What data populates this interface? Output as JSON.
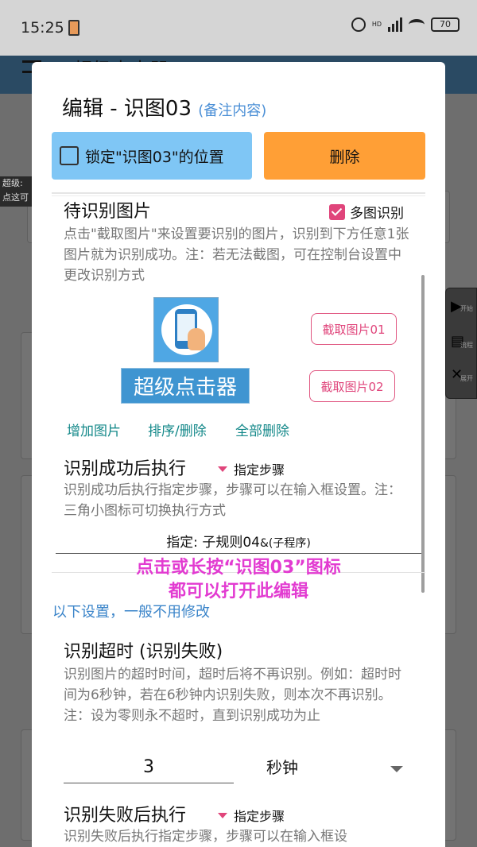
{
  "status_bar": {
    "time": "15:25",
    "network": "HD",
    "battery": "70"
  },
  "app_bar": {
    "title": "超级点击器"
  },
  "background": {
    "tooltip": "超级:\n点这可"
  },
  "side_panel": {
    "labels": [
      "开始",
      "流程",
      "展开"
    ]
  },
  "dialog": {
    "title": "编辑 - 识图03",
    "title_note": "(备注内容)",
    "lock_label": "锁定\"识图03\"的位置",
    "delete_label": "删除",
    "image_section": {
      "heading": "待识别图片",
      "multi_label": "多图识别",
      "multi_checked": true,
      "desc": "点击\"截取图片\"来设置要识别的图片，识别到下方任意1张图片就为识别成功。注：若无法截图，可在控制台设置中更改识别方式",
      "image2_text": "超级点击器",
      "capture1": "截取图片01",
      "capture2": "截取图片02",
      "links": [
        "增加图片",
        "排序/删除",
        "全部删除"
      ]
    },
    "success_section": {
      "heading": "识别成功后执行",
      "select": "指定步骤",
      "desc": "识别成功后执行指定步骤，步骤可以在输入框设置。注：三角小图标可切换执行方式",
      "assigned_prefix": "指定: 子规则04",
      "assigned_suffix": "&(子程序)"
    },
    "overlay": {
      "line1": "点击或长按“识图03”图标",
      "line2": "都可以打开此编辑"
    },
    "note": "以下设置，一般不用修改",
    "timeout_section": {
      "heading": "识别超时 (识别失败)",
      "desc": "识别图片的超时时间，超时后将不再识别。例如：超时时间为6秒钟，若在6秒钟内识别失败，则本次不再识别。注：设为零则永不超时，直到识别成功为止",
      "value": "3",
      "unit": "秒钟"
    },
    "fail_section": {
      "heading": "识别失败后执行",
      "select": "指定步骤",
      "desc": "识别失败后执行指定步骤，步骤可以在输入框设"
    }
  },
  "colors": {
    "primary_blue": "#7fc6f5",
    "delete_orange": "#ff9f36",
    "accent_pink": "#e0457b",
    "teal_link": "#15898a",
    "overlay_magenta": "#e23bd1"
  }
}
